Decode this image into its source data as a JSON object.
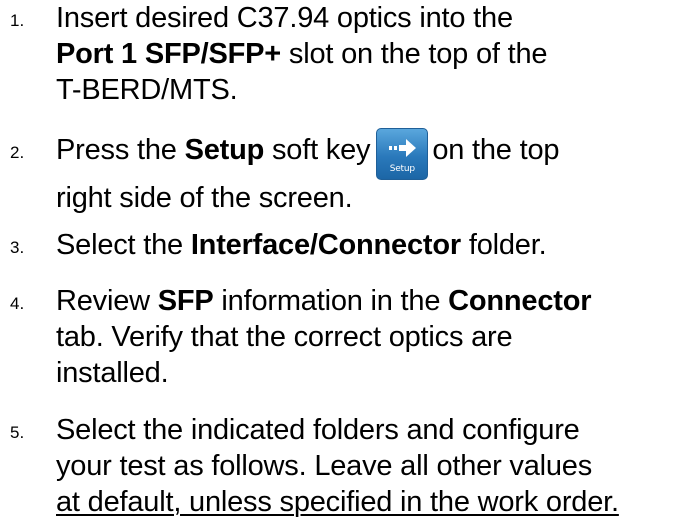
{
  "steps": [
    {
      "number": "1.",
      "lines": [
        [
          {
            "t": "Insert desired C37.94 optics into the",
            "b": false
          }
        ],
        [
          {
            "t": "Port 1 SFP/SFP+",
            "b": true
          },
          {
            "t": " slot on the top of the",
            "b": false
          }
        ],
        [
          {
            "t": "T-BERD/MTS.",
            "b": false
          }
        ]
      ]
    },
    {
      "number": "2.",
      "lines": [
        [
          {
            "t": "Press the ",
            "b": false
          },
          {
            "t": "Setup",
            "b": true
          },
          {
            "t": " soft key",
            "b": false
          },
          {
            "key": true
          },
          {
            "t": "on the top",
            "b": false
          }
        ],
        [
          {
            "t": "right side of the screen.",
            "b": false
          }
        ]
      ]
    },
    {
      "number": "3.",
      "lines": [
        [
          {
            "t": "Select the ",
            "b": false
          },
          {
            "t": "Interface/Connector",
            "b": true
          },
          {
            "t": " folder.",
            "b": false
          }
        ]
      ]
    },
    {
      "number": "4.",
      "lines": [
        [
          {
            "t": "Review ",
            "b": false
          },
          {
            "t": "SFP",
            "b": true
          },
          {
            "t": " information in the ",
            "b": false
          },
          {
            "t": "Connector",
            "b": true
          }
        ],
        [
          {
            "t": "tab.  Verify that the correct optics are",
            "b": false
          }
        ],
        [
          {
            "t": "installed.",
            "b": false
          }
        ]
      ]
    },
    {
      "number": "5.",
      "lines": [
        [
          {
            "t": "Select the indicated folders and configure",
            "b": false
          }
        ],
        [
          {
            "t": "your test as follows.  Leave all other values",
            "b": false
          }
        ],
        [
          {
            "t": "at default, unless specified in the work order.",
            "b": false,
            "u": true
          }
        ]
      ]
    }
  ],
  "setup_key": {
    "label": "Setup",
    "icon": "right-arrow-icon",
    "colors": {
      "top": "#5aa7dd",
      "bottom": "#1c66a6"
    }
  }
}
